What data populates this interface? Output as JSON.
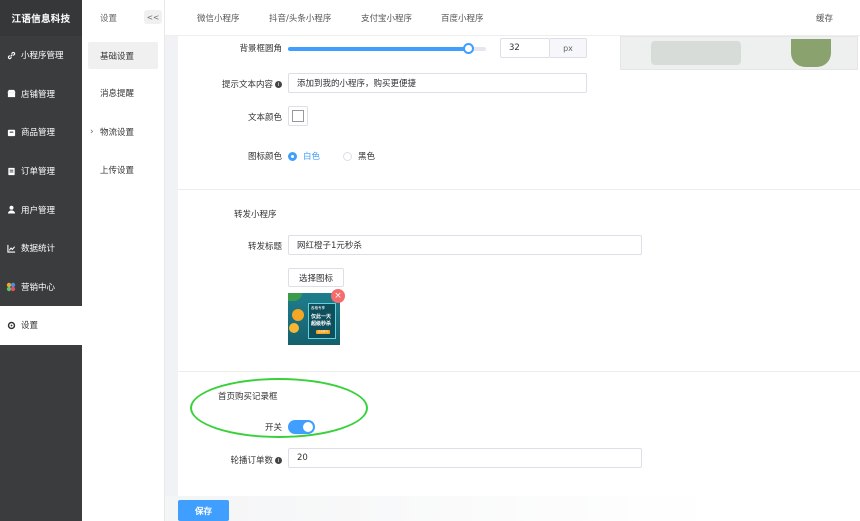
{
  "brand": "江语信息科技",
  "sidebar": {
    "items": [
      {
        "label": "小程序管理",
        "icon": "link-icon"
      },
      {
        "label": "店铺管理",
        "icon": "store-icon"
      },
      {
        "label": "商品管理",
        "icon": "product-icon"
      },
      {
        "label": "订单管理",
        "icon": "order-icon"
      },
      {
        "label": "用户管理",
        "icon": "user-icon"
      },
      {
        "label": "数据统计",
        "icon": "chart-icon"
      },
      {
        "label": "营销中心",
        "icon": "marketing-icon"
      },
      {
        "label": "设置",
        "icon": "gear-icon"
      }
    ]
  },
  "submenu": {
    "title": "设置",
    "collapse": "<<",
    "items": [
      {
        "label": "基础设置"
      },
      {
        "label": "消息提醒"
      },
      {
        "label": "物流设置"
      },
      {
        "label": "上传设置"
      }
    ]
  },
  "tabs": [
    "微信小程序",
    "抖音/头条小程序",
    "支付宝小程序",
    "百度小程序"
  ],
  "cache": "缓存",
  "form": {
    "radius_label": "背景框圆角",
    "radius_value": "32",
    "radius_unit": "px",
    "radius_level": 0.91,
    "tip_label": "提示文本内容",
    "tip_value": "添加到我的小程序，购买更便捷",
    "text_color_label": "文本颜色",
    "icon_color_label": "图标颜色",
    "icon_color_white": "白色",
    "icon_color_black": "黑色",
    "share_section": "转发小程序",
    "share_title_label": "转发标题",
    "share_title_value": "网红橙子1元秒杀",
    "choose_icon": "选择图标",
    "purchase_section": "首页购买记录框",
    "switch_label": "开关",
    "carousel_label": "轮播订单数",
    "carousel_value": "20"
  },
  "thumb": {
    "tag": "各格专享",
    "line1": "仅此一天",
    "line2": "超级秒杀",
    "cta": "点击参与"
  },
  "save": "保存",
  "colors": {
    "accent": "#409eff",
    "annotation": "#39d13a",
    "sidebar": "#3b3c3e"
  }
}
